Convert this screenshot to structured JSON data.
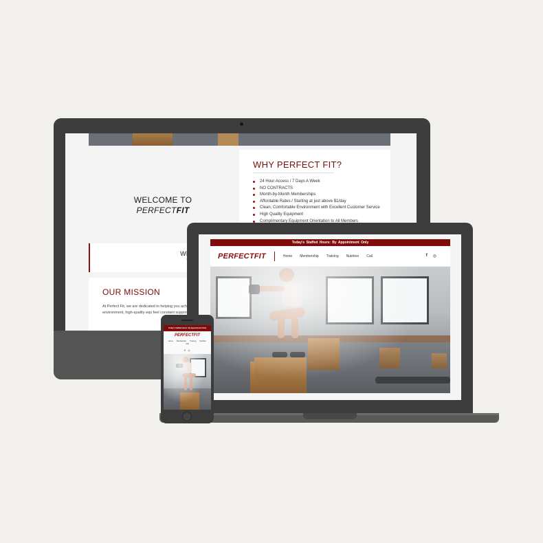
{
  "desktop": {
    "welcome_line1": "WELCOME TO",
    "welcome_brand_a": "PERFECT",
    "welcome_brand_b": "FIT",
    "why_title": "WHY PERFECT FIT?",
    "why_items": [
      "24 Hour Access / 7 Days A Week",
      "NO CONTRACTS",
      "Month-by-Month Memberships",
      "Affordable Rates / Starting at just above $1/day",
      "Clean, Comfortable Environment with Excellent Customer Service",
      "High Quality Equipment",
      "Complimentary Equipment Orientation to All Members"
    ],
    "invest_line1": "WE INV",
    "invest_line2": "WE",
    "mission_title": "OUR MISSION",
    "mission_text": "At Perfect Fit, we are dedicated to helping you achi and comfortable environment, high-quality equ feel constant support, and that's ex"
  },
  "laptop": {
    "topbar": "Today's Staffed Hours:   By Appointment Only",
    "logo_a": "PERFECT",
    "logo_b": "FIT",
    "nav": [
      "Home",
      "Membership",
      "Training",
      "Nutrition",
      "Call"
    ],
    "social_icons": [
      "facebook-icon",
      "instagram-icon"
    ],
    "social_glyphs": [
      "f",
      "◎"
    ]
  },
  "phone": {
    "topbar": "Today's Staffed Hours:   By Appointment Only",
    "logo_a": "PERFECT",
    "logo_b": "FIT",
    "nav": [
      "Home",
      "Membership",
      "Training",
      "Nutrition",
      "Call"
    ],
    "social_glyphs": [
      "f",
      "◎"
    ]
  },
  "colors": {
    "brand_red": "#7f0b0b",
    "background": "#f1f0ec",
    "device_dark": "#3c3c3c"
  }
}
